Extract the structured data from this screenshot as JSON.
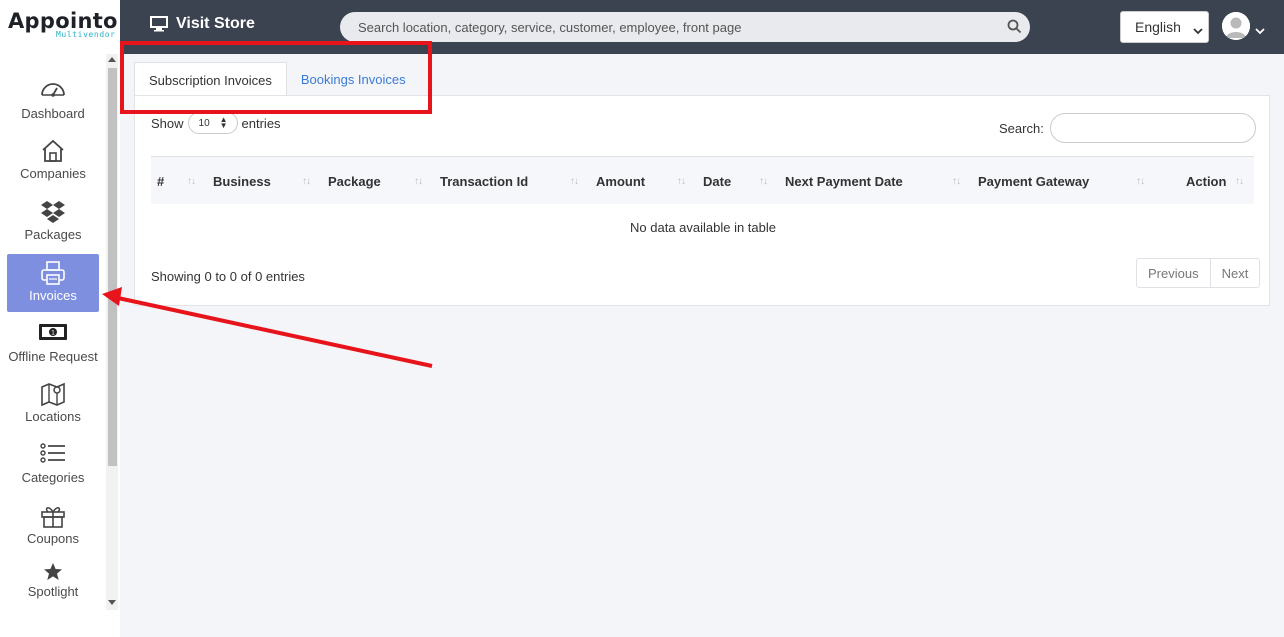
{
  "brand": {
    "name": "Appointo",
    "subtitle": "Multivendor",
    "accent_color": "#2bb3c8"
  },
  "sidebar": {
    "items": [
      {
        "label": "Dashboard",
        "icon": "gauge-icon"
      },
      {
        "label": "Companies",
        "icon": "home-icon"
      },
      {
        "label": "Packages",
        "icon": "dropbox-icon"
      },
      {
        "label": "Invoices",
        "icon": "printer-icon",
        "active": true
      },
      {
        "label": "Offline Request",
        "icon": "money-bill-icon"
      },
      {
        "label": "Locations",
        "icon": "map-icon"
      },
      {
        "label": "Categories",
        "icon": "list-icon"
      },
      {
        "label": "Coupons",
        "icon": "gift-icon"
      },
      {
        "label": "Spotlight",
        "icon": "star-icon"
      }
    ],
    "active_color": "#7e8fe0"
  },
  "topbar": {
    "visit_store": "Visit Store",
    "search_placeholder": "Search location, category, service, customer, employee, front page",
    "language": "English",
    "background": "#3c4350"
  },
  "tabs": [
    {
      "label": "Subscription Invoices",
      "active": true
    },
    {
      "label": "Bookings Invoices",
      "active": false
    }
  ],
  "table": {
    "show_label": "Show",
    "entries_value": "10",
    "entries_label": "entries",
    "search_label": "Search:",
    "columns": [
      "#",
      "Business",
      "Package",
      "Transaction Id",
      "Amount",
      "Date",
      "Next Payment Date",
      "Payment Gateway",
      "Action"
    ],
    "empty_message": "No data available in table",
    "info": "Showing 0 to 0 of 0 entries",
    "previous": "Previous",
    "next": "Next"
  },
  "annotation_color": "#e8141b"
}
